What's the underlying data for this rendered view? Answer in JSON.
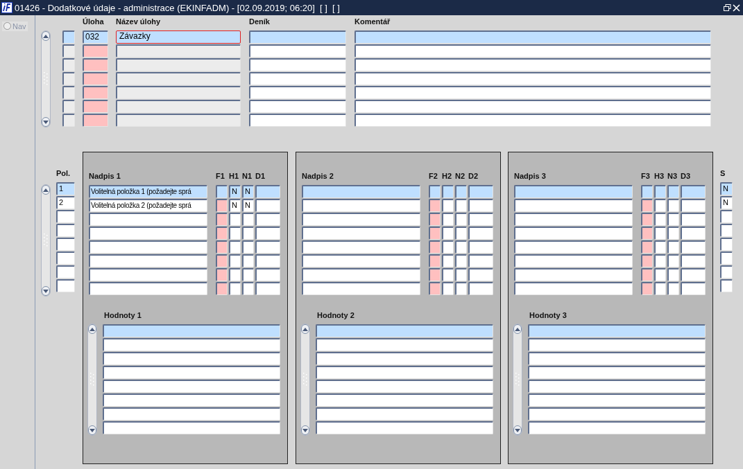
{
  "window": {
    "title": "01426 - Dodatkové údaje - administrace (EKINFADM) - [02.09.2019; 06:20]  [ ]  [ ]"
  },
  "nav": {
    "label": "Nav",
    "disabled": true,
    "selected": false
  },
  "top": {
    "columns": [
      {
        "kind": "readonly"
      },
      {
        "label": "Úloha",
        "kind": "required"
      },
      {
        "label": "Název úlohy",
        "kind": "readonly"
      },
      {
        "label": "Deník",
        "kind": "plain"
      },
      {
        "label": "Komentář",
        "kind": "plain"
      }
    ],
    "rows": [
      {
        "selected": true,
        "cells": [
          {
            "focused": false
          },
          {
            "value": "032",
            "focused": false
          },
          {
            "value": "Závazky",
            "focused": true
          },
          {
            "focused": false
          },
          {
            "focused": false
          }
        ]
      },
      {
        "selected": false,
        "cells": [
          {
            "focused": false
          },
          {
            "focused": false
          },
          {
            "focused": false
          },
          {
            "focused": false
          },
          {
            "focused": false
          }
        ]
      },
      {
        "selected": false,
        "cells": [
          {
            "focused": false
          },
          {
            "focused": false
          },
          {
            "focused": false
          },
          {
            "focused": false
          },
          {
            "focused": false
          }
        ]
      },
      {
        "selected": false,
        "cells": [
          {
            "focused": false
          },
          {
            "focused": false
          },
          {
            "focused": false
          },
          {
            "focused": false
          },
          {
            "focused": false
          }
        ]
      },
      {
        "selected": false,
        "cells": [
          {
            "focused": false
          },
          {
            "focused": false
          },
          {
            "focused": false
          },
          {
            "focused": false
          },
          {
            "focused": false
          }
        ]
      },
      {
        "selected": false,
        "cells": [
          {
            "focused": false
          },
          {
            "focused": false
          },
          {
            "focused": false
          },
          {
            "focused": false
          },
          {
            "focused": false
          }
        ]
      },
      {
        "selected": false,
        "cells": [
          {
            "focused": false
          },
          {
            "focused": false
          },
          {
            "focused": false
          },
          {
            "focused": false
          },
          {
            "focused": false
          }
        ]
      }
    ]
  },
  "bottom": {
    "pol_label": "Pol.",
    "s_label": "S",
    "groups": [
      {
        "columns": [
          {
            "label": "Nadpis 1",
            "kind": "plain"
          },
          {
            "label": "F1",
            "kind": "required"
          },
          {
            "label": "H1",
            "kind": "plain"
          },
          {
            "label": "N1",
            "kind": "plain"
          },
          {
            "label": "D1",
            "kind": "plain"
          }
        ],
        "values_label": "Hodnoty 1",
        "values": [
          {
            "selected": true
          },
          {
            "selected": false
          },
          {
            "selected": false
          },
          {
            "selected": false
          },
          {
            "selected": false
          },
          {
            "selected": false
          },
          {
            "selected": false
          },
          {
            "selected": false
          }
        ]
      },
      {
        "columns": [
          {
            "label": "Nadpis 2",
            "kind": "plain"
          },
          {
            "label": "F2",
            "kind": "required"
          },
          {
            "label": "H2",
            "kind": "plain"
          },
          {
            "label": "N2",
            "kind": "plain"
          },
          {
            "label": "D2",
            "kind": "plain"
          }
        ],
        "values_label": "Hodnoty 2",
        "values": [
          {
            "selected": true
          },
          {
            "selected": false
          },
          {
            "selected": false
          },
          {
            "selected": false
          },
          {
            "selected": false
          },
          {
            "selected": false
          },
          {
            "selected": false
          },
          {
            "selected": false
          }
        ]
      },
      {
        "columns": [
          {
            "label": "Nadpis 3",
            "kind": "plain"
          },
          {
            "label": "F3",
            "kind": "required"
          },
          {
            "label": "H3",
            "kind": "plain"
          },
          {
            "label": "N3",
            "kind": "plain"
          },
          {
            "label": "D3",
            "kind": "plain"
          }
        ],
        "values_label": "Hodnoty 3",
        "values": [
          {
            "selected": true
          },
          {
            "selected": false
          },
          {
            "selected": false
          },
          {
            "selected": false
          },
          {
            "selected": false
          },
          {
            "selected": false
          },
          {
            "selected": false
          },
          {
            "selected": false
          }
        ]
      }
    ],
    "rows": [
      {
        "selected": true,
        "pol": "1",
        "s": "N",
        "groups": [
          {
            "nadpis": "Volitelná položka 1 (požadejte sprá",
            "h": "N",
            "n": "N"
          }
        ]
      },
      {
        "selected": false,
        "pol": "2",
        "s": "N",
        "groups": [
          {
            "nadpis": "Volitelná položka 2 (požadejte sprá",
            "h": "N",
            "n": "N"
          }
        ]
      },
      {
        "selected": false
      },
      {
        "selected": false
      },
      {
        "selected": false
      },
      {
        "selected": false
      },
      {
        "selected": false
      },
      {
        "selected": false
      }
    ]
  }
}
